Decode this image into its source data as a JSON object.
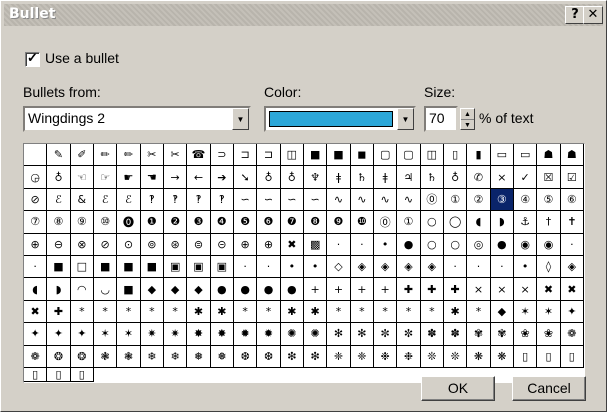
{
  "window": {
    "title": "Bullet",
    "help_label": "?",
    "close_label": "✕"
  },
  "use_bullet": {
    "label": "Use a bullet",
    "checked": true,
    "check_glyph": "✓"
  },
  "bullets_from": {
    "label": "Bullets from:",
    "value": "Wingdings 2"
  },
  "color": {
    "label": "Color:",
    "value_hex": "#2ca7d8"
  },
  "size": {
    "label": "Size:",
    "value": "70",
    "suffix": "% of text"
  },
  "grid": {
    "selected_index": 68,
    "symbols": [
      "",
      "✎",
      "✐",
      "✏",
      "✏",
      "✂",
      "✂",
      "☎",
      "⊃",
      "⊐",
      "⊐",
      "◫",
      "■",
      "■",
      "◼",
      "▢",
      "▢",
      "◫",
      "▯",
      "▮",
      "▭",
      "▭",
      "☗",
      "☗",
      "◶",
      "♁",
      "☜",
      "☞",
      "☛",
      "☚",
      "→",
      "←",
      "➔",
      "➘",
      "♁",
      "♁",
      "♆",
      "ǂ",
      "♄",
      "ǂ",
      "♃",
      "♄",
      "♁",
      "✆",
      "×",
      "✓",
      "☒",
      "☑",
      "⊘",
      "ℰ",
      "&",
      "ℰ",
      "ℰ",
      "‽",
      "‽",
      "‽",
      "‽",
      "∽",
      "∽",
      "∽",
      "∽",
      "∿",
      "∿",
      "∿",
      "∿",
      "⓪",
      "①",
      "②",
      "③",
      "④",
      "⑤",
      "⑥",
      "⑦",
      "⑧",
      "⑨",
      "⑩",
      "⓿",
      "❶",
      "❷",
      "❸",
      "❹",
      "❺",
      "❻",
      "❼",
      "❽",
      "❾",
      "❿",
      "⓪",
      "①",
      "○",
      "◯",
      "◖",
      "◗",
      "⚓",
      "†",
      "✝",
      "⊕",
      "⊖",
      "⊗",
      "⊘",
      "⊙",
      "⊚",
      "⊛",
      "⊜",
      "⊝",
      "⊕",
      "⊕",
      "✖",
      "▩",
      "·",
      "·",
      "•",
      "●",
      "○",
      "○",
      "◎",
      "●",
      "◉",
      "◉",
      "·",
      "·",
      "■",
      "□",
      "■",
      "■",
      "■",
      "▣",
      "▣",
      "▣",
      "·",
      "·",
      "•",
      "•",
      "◇",
      "◈",
      "◈",
      "◈",
      "◈",
      "·",
      "·",
      "·",
      "•",
      "◊",
      "◈",
      "◖",
      "◗",
      "◠",
      "◡",
      "■",
      "◆",
      "◆",
      "◆",
      "●",
      "●",
      "●",
      "●",
      "+",
      "+",
      "+",
      "+",
      "✚",
      "✚",
      "✚",
      "×",
      "×",
      "×",
      "✖",
      "✖",
      "✖",
      "✚",
      "*",
      "*",
      "*",
      "*",
      "*",
      "✱",
      "✱",
      "*",
      "*",
      "✱",
      "✱",
      "*",
      "*",
      "*",
      "*",
      "*",
      "✱",
      "*",
      "◆",
      "✶",
      "✶",
      "✦",
      "✦",
      "✦",
      "✦",
      "✶",
      "✶",
      "✷",
      "✷",
      "✸",
      "✸",
      "✹",
      "✹",
      "✺",
      "✺",
      "✻",
      "✻",
      "✼",
      "✼",
      "✽",
      "✽",
      "✾",
      "✾",
      "❀",
      "❀",
      "❁",
      "❁",
      "❂",
      "❂",
      "❃",
      "❃",
      "❄",
      "❄",
      "❅",
      "❅",
      "❆",
      "❆",
      "❇",
      "❇",
      "❈",
      "❈",
      "❉",
      "❉",
      "❊",
      "❊",
      "❋",
      "❋",
      "▯",
      "▯",
      "▯",
      "▯",
      "▯",
      "▯"
    ]
  },
  "buttons": {
    "ok": "OK",
    "cancel": "Cancel"
  }
}
